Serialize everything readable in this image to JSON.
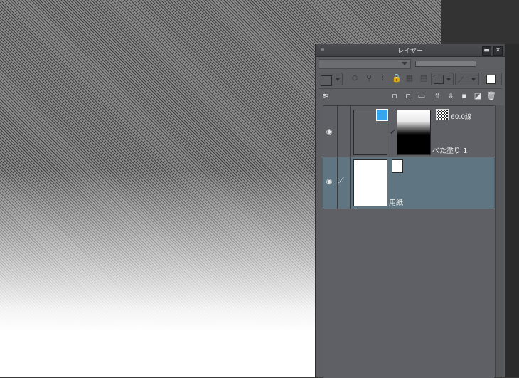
{
  "palette": {
    "title": "レイヤー",
    "grip_icon": "≡",
    "minimize_icon": "▬",
    "close_icon": "✕"
  },
  "toolbar": {
    "blend_mode": "",
    "opacity": ""
  },
  "layers": [
    {
      "name": "べた塗り 1",
      "info": "60.0線",
      "visible": true,
      "selected": false,
      "type": "fill-with-mask"
    },
    {
      "name": "用紙",
      "info": "",
      "visible": true,
      "selected": true,
      "type": "paper"
    }
  ],
  "colors": {
    "selected_row": "#5f7682",
    "panel_bg": "#5d5f63",
    "accent_blue": "#36a6f0"
  }
}
